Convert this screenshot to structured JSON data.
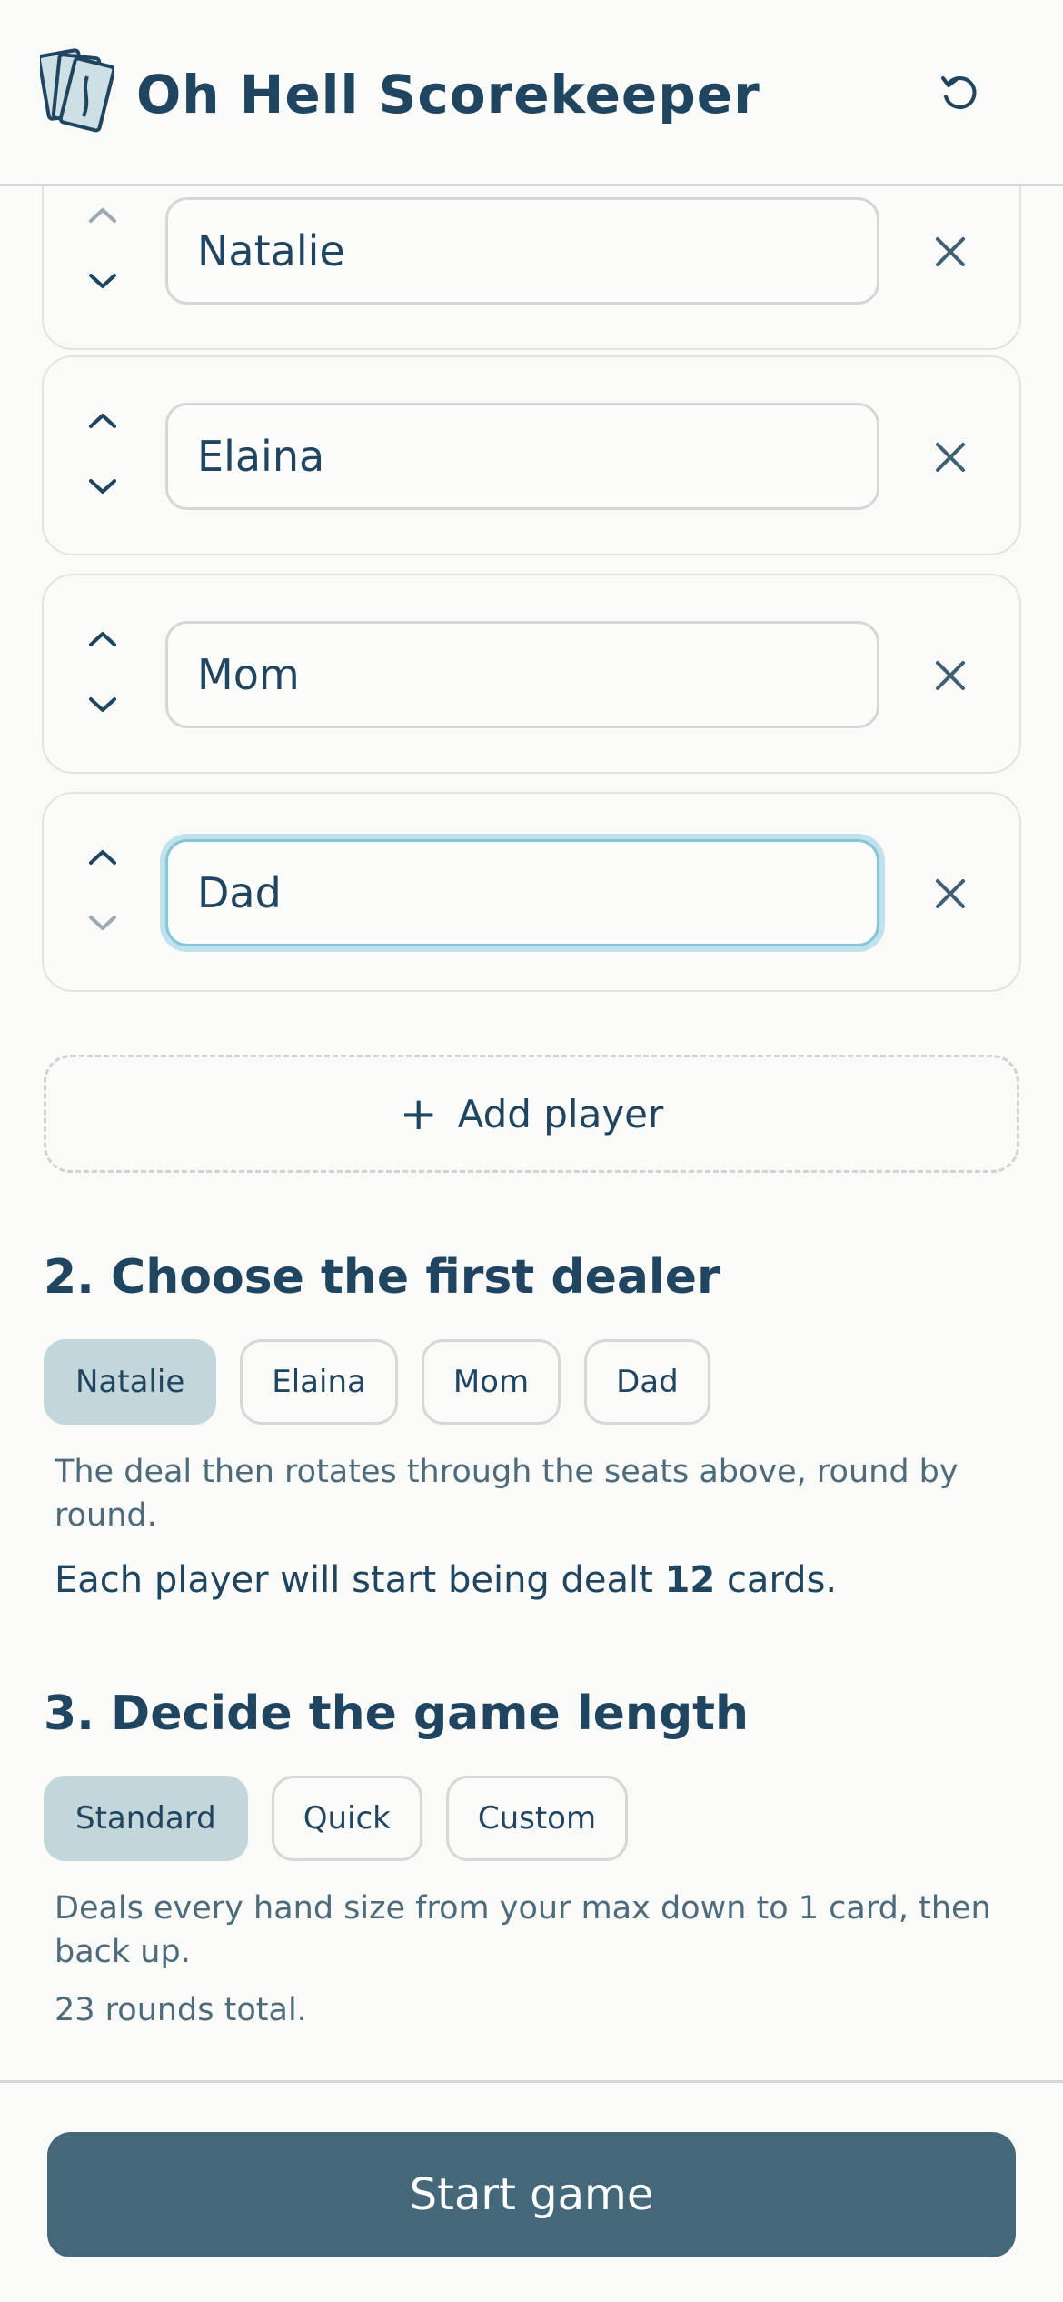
{
  "app": {
    "title": "Oh Hell Scorekeeper",
    "logo_icon": "playing-cards-icon",
    "reset_icon": "refresh-icon"
  },
  "players": [
    {
      "name": "Natalie"
    },
    {
      "name": "Elaina"
    },
    {
      "name": "Mom"
    },
    {
      "name": "Dad"
    }
  ],
  "add_player": {
    "plus": "+",
    "label": "Add player"
  },
  "dealer_section": {
    "title": "2. Choose the first dealer",
    "options": [
      "Natalie",
      "Elaina",
      "Mom",
      "Dad"
    ],
    "selected": "Natalie",
    "help": "The deal then rotates through the seats above, round by round.",
    "deal_prefix": "Each player will start being dealt",
    "deal_count": "12",
    "deal_suffix": "cards."
  },
  "length_section": {
    "title": "3. Decide the game length",
    "options": [
      "Standard",
      "Quick",
      "Custom"
    ],
    "selected": "Standard",
    "help": "Deals every hand size from your max down to 1 card, then back up.",
    "rounds": "23 rounds total."
  },
  "footer": {
    "start_label": "Start game"
  },
  "colors": {
    "primary": "#1f4560",
    "button": "#44677a",
    "chip_selected": "#c3d6d9",
    "focus_ring": "#bfe2ec",
    "background": "#fafaf8"
  }
}
